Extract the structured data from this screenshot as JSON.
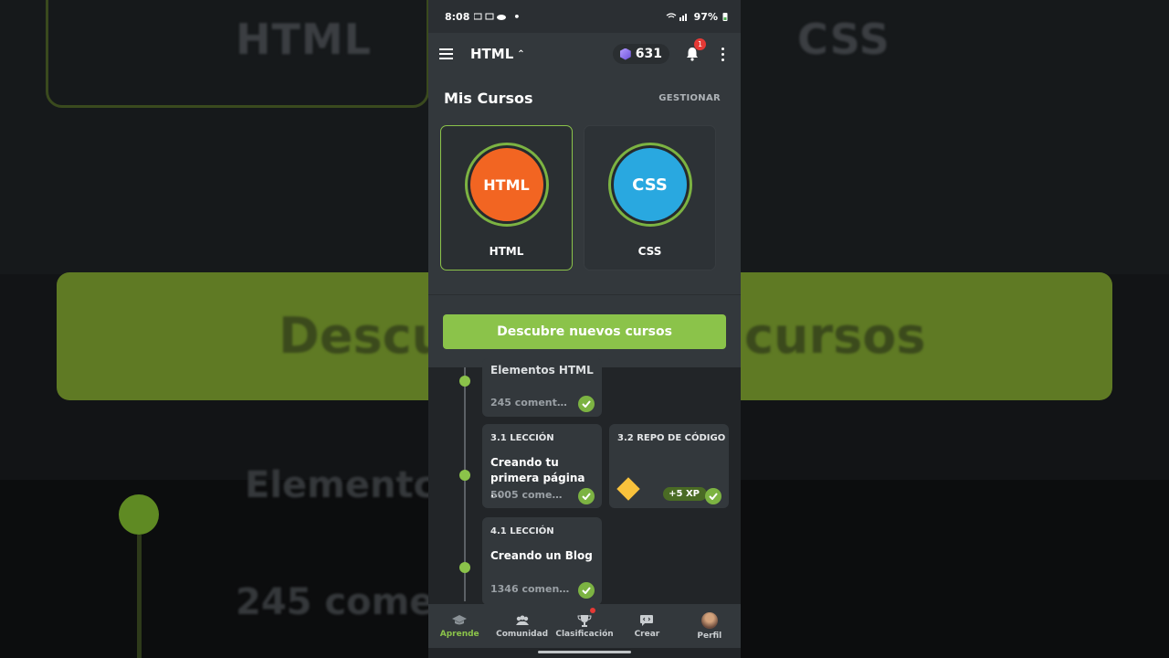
{
  "background": {
    "word_left": "HTML",
    "word_right": "CSS",
    "banner_left": "Descu",
    "banner_right": "cursos",
    "lower_word": "Elementc",
    "lower_comments": "245 come"
  },
  "status_bar": {
    "time": "8:08",
    "battery": "97%"
  },
  "app_bar": {
    "course": "HTML",
    "gems": "631",
    "notifications": "1"
  },
  "my_courses": {
    "title": "Mis Cursos",
    "manage": "GESTIONAR",
    "courses": [
      {
        "logo": "HTML",
        "label": "HTML",
        "color": "#f26522",
        "active": true
      },
      {
        "logo": "CSS",
        "label": "CSS",
        "color": "#29a8e0",
        "active": false
      }
    ],
    "discover_button": "Descubre nuevos cursos"
  },
  "path": {
    "lessons": [
      {
        "tag": "",
        "name": "Elementos HTML",
        "meta": "245 coment…",
        "completed": true
      },
      {
        "tag": "3.1 LECCIÓN",
        "name": "Creando tu primera página …",
        "meta": "5005 come…",
        "completed": true
      },
      {
        "tag": "3.2 REPO DE CÓDIGO",
        "name": "",
        "meta": "",
        "xp": "+5 XP",
        "completed": true
      },
      {
        "tag": "4.1 LECCIÓN",
        "name": "Creando un Blog",
        "meta": "1346 comen…",
        "completed": true
      }
    ]
  },
  "bottom_nav": [
    {
      "label": "Aprende",
      "icon": "graduation-cap-icon",
      "active": true
    },
    {
      "label": "Comunidad",
      "icon": "community-icon",
      "active": false
    },
    {
      "label": "Clasificación",
      "icon": "trophy-icon",
      "active": false
    },
    {
      "label": "Crear",
      "icon": "code-bubble-icon",
      "active": false
    },
    {
      "label": "Perfil",
      "icon": "avatar-icon",
      "active": false
    }
  ],
  "colors": {
    "accent": "#8bc34a",
    "html": "#f26522",
    "css": "#29a8e0"
  }
}
